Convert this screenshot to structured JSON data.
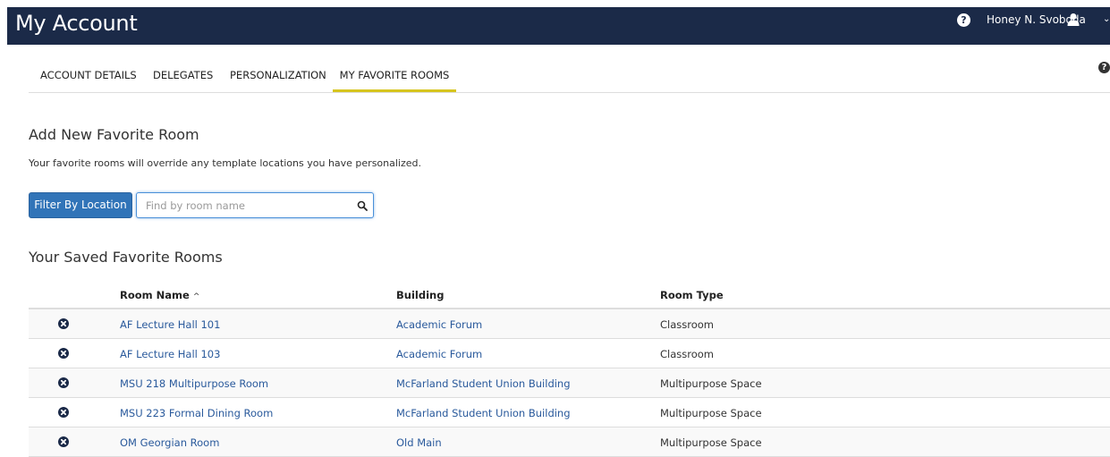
{
  "header": {
    "title": "My Account",
    "help_icon": "question-circle-icon",
    "user_name": "Honey N. Svoboda",
    "user_icon": "user-icon",
    "chevron_icon": "chevron-down-icon"
  },
  "tabs": [
    {
      "label": "ACCOUNT DETAILS",
      "active": false
    },
    {
      "label": "DELEGATES",
      "active": false
    },
    {
      "label": "PERSONALIZATION",
      "active": false
    },
    {
      "label": "MY FAVORITE ROOMS",
      "active": true
    }
  ],
  "add_section": {
    "title": "Add New Favorite Room",
    "note": "Your favorite rooms will override any template locations you have personalized.",
    "filter_button_label": "Filter By Location",
    "search_placeholder": "Find by room name",
    "search_value": ""
  },
  "saved_section": {
    "title": "Your Saved Favorite Rooms",
    "columns": [
      "Room Name",
      "Building",
      "Room Type"
    ],
    "sort_indicator": "^",
    "rows": [
      {
        "room": "AF Lecture Hall 101",
        "building": "Academic Forum",
        "type": "Classroom"
      },
      {
        "room": "AF Lecture Hall 103",
        "building": "Academic Forum",
        "type": "Classroom"
      },
      {
        "room": "MSU 218 Multipurpose Room",
        "building": "McFarland Student Union Building",
        "type": "Multipurpose Space"
      },
      {
        "room": "MSU 223 Formal Dining Room",
        "building": "McFarland Student Union Building",
        "type": "Multipurpose Space"
      },
      {
        "room": "OM Georgian Room",
        "building": "Old Main",
        "type": "Multipurpose Space"
      }
    ]
  },
  "colors": {
    "header_bg": "#1b2a48",
    "active_tab_underline": "#d7c51f",
    "primary_button": "#3174b8",
    "link": "#2a5a9c"
  }
}
